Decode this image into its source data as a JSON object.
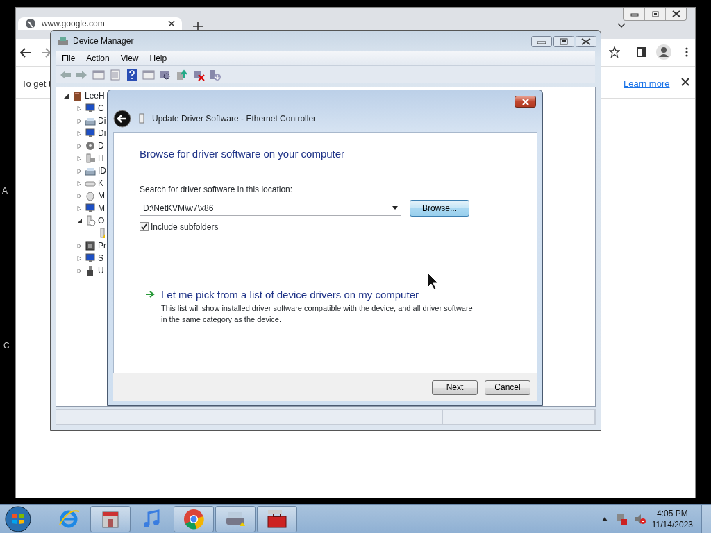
{
  "desktop_fragments": [
    "A",
    "C"
  ],
  "browser": {
    "tab": {
      "title": "www.google.com"
    },
    "infobar": {
      "text": "To get t",
      "link": "Learn more"
    }
  },
  "device_manager": {
    "title": "Device Manager",
    "menu": [
      "File",
      "Action",
      "View",
      "Help"
    ],
    "tree": {
      "label": "LeeH",
      "kind": "computer",
      "expanded": true,
      "children": [
        {
          "label": "C",
          "kind": "monitor",
          "expanded": false
        },
        {
          "label": "Di",
          "kind": "disk",
          "expanded": false
        },
        {
          "label": "Di",
          "kind": "monitor",
          "expanded": false
        },
        {
          "label": "D",
          "kind": "drive",
          "expanded": false
        },
        {
          "label": "H",
          "kind": "hid",
          "expanded": false
        },
        {
          "label": "ID",
          "kind": "disk",
          "expanded": false
        },
        {
          "label": "K",
          "kind": "keyboard",
          "expanded": false
        },
        {
          "label": "M",
          "kind": "mouse",
          "expanded": false
        },
        {
          "label": "M",
          "kind": "monitor",
          "expanded": false
        },
        {
          "label": "O",
          "kind": "unknown",
          "expanded": true,
          "children": [
            {
              "kind": "warning"
            }
          ]
        },
        {
          "label": "Pr",
          "kind": "chip",
          "expanded": false
        },
        {
          "label": "S",
          "kind": "monitor",
          "expanded": false
        },
        {
          "label": "U",
          "kind": "usb",
          "expanded": false
        }
      ]
    }
  },
  "wizard": {
    "title": "Update Driver Software - Ethernet Controller",
    "heading": "Browse for driver software on your computer",
    "location_label": "Search for driver software in this location:",
    "location_value": "D:\\NetKVM\\w7\\x86",
    "browse_button": "Browse...",
    "include_subfolders": {
      "label": "Include subfolders",
      "checked": true
    },
    "pick_option": {
      "title": "Let me pick from a list of device drivers on my computer",
      "description": "This list will show installed driver software compatible with the device, and all driver software in the same category as the device."
    },
    "buttons": [
      "Next",
      "Cancel"
    ]
  },
  "taskbar": {
    "apps": [
      {
        "kind": "ie",
        "running": false
      },
      {
        "kind": "store",
        "running": true
      },
      {
        "kind": "music",
        "running": false
      },
      {
        "kind": "chrome",
        "running": true
      },
      {
        "kind": "drive",
        "running": true
      },
      {
        "kind": "toolbox",
        "running": true
      }
    ],
    "clock": {
      "time": "4:05 PM",
      "date": "11/14/2023"
    }
  }
}
